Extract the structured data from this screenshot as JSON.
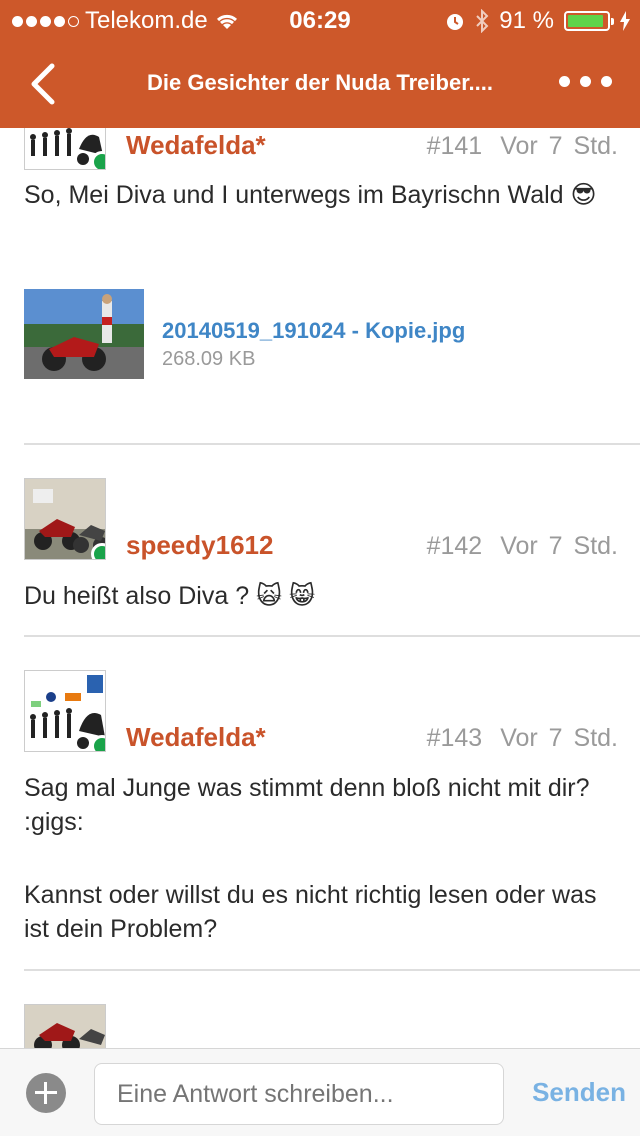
{
  "status_bar": {
    "carrier": "Telekom.de",
    "time": "06:29",
    "battery_percent": "91 %",
    "battery_level": 0.91,
    "icons": [
      "signal-dots-icon",
      "wifi-icon",
      "alarm-icon",
      "bluetooth-icon",
      "battery-icon",
      "charging-icon"
    ]
  },
  "nav": {
    "title": "Die Gesichter der Nuda Treiber....",
    "back_icon": "chevron-left-icon",
    "more_icon": "more-dots-icon"
  },
  "posts": [
    {
      "username": "Wedafelda*",
      "number": "#141",
      "time": "Vor 7 Std.",
      "text": "So, Mei Diva und I unterwegs im Bayrischn Wald 😎",
      "attachment": {
        "filename": "20140519_191024 - Kopie.jpg",
        "size": "268.09 KB"
      }
    },
    {
      "username": "speedy1612",
      "number": "#142",
      "time": "Vor 7 Std.",
      "text": "Du heißt also Diva ? 🙀 😸"
    },
    {
      "username": "Wedafelda*",
      "number": "#143",
      "time": "Vor 7 Std.",
      "text_lines": [
        "Sag mal Junge was stimmt denn bloß nicht mit dir? :gigs:",
        "Kannst oder willst du es nicht richtig lesen oder was ist dein Problem?"
      ]
    }
  ],
  "composer": {
    "placeholder": "Eine Antwort schreiben...",
    "send_label": "Senden"
  },
  "colors": {
    "header": "#cd582a",
    "username": "#c9532a",
    "link": "#3f86c6",
    "online": "#1aa34a",
    "send": "#79b2e3"
  }
}
